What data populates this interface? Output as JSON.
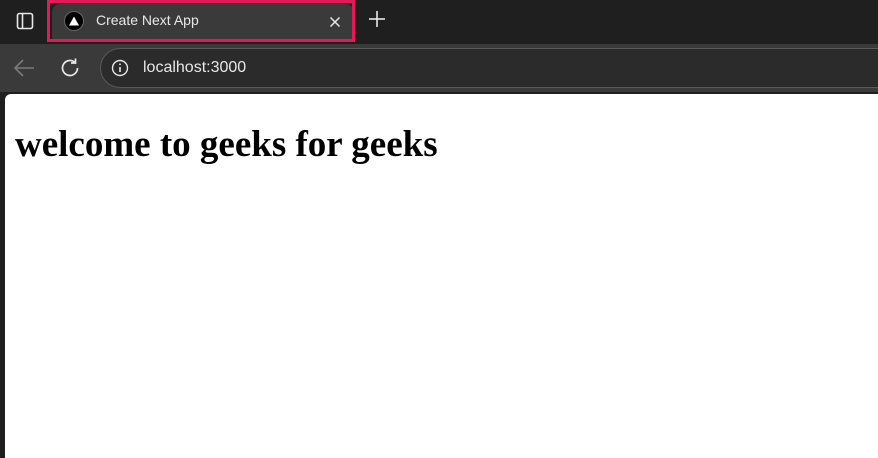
{
  "tab": {
    "title": "Create Next App",
    "favicon": "nextjs-triangle-icon"
  },
  "toolbar": {
    "url": "localhost:3000"
  },
  "page": {
    "heading": "welcome to geeks for geeks"
  },
  "colors": {
    "highlight": "#e3195a",
    "tab_active": "#3a3a3a",
    "tab_strip": "#1f1f1f",
    "page_background": "#ffffff"
  }
}
